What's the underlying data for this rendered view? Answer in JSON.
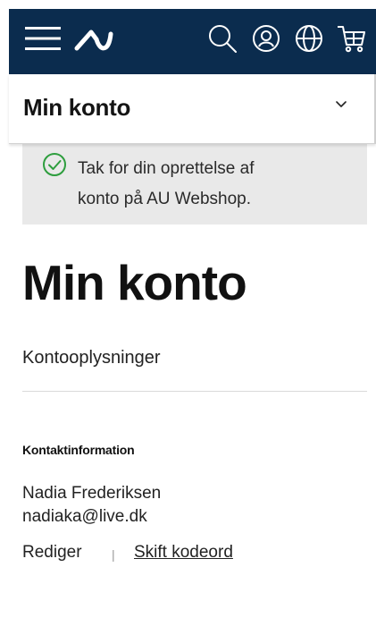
{
  "header": {
    "background_color": "#0b2c4e",
    "icons": [
      "menu-icon",
      "logo-icon",
      "search-icon",
      "user-icon",
      "globe-icon",
      "cart-icon"
    ]
  },
  "account_bar": {
    "title": "Min konto",
    "toggle_icon": "chevron-down-icon"
  },
  "notice": {
    "icon": "check-circle-icon",
    "icon_color": "#2e9e3e",
    "line1": "Tak for din oprettelse af",
    "line2": "konto på AU Webshop."
  },
  "main": {
    "heading": "Min konto",
    "section_link": "Kontooplysninger",
    "contact": {
      "heading": "Kontaktinformation",
      "name": "Nadia Frederiksen",
      "email": "nadiaka@live.dk"
    },
    "actions": {
      "edit": "Rediger",
      "separator": "|",
      "change_password": "Skift kodeord"
    }
  }
}
